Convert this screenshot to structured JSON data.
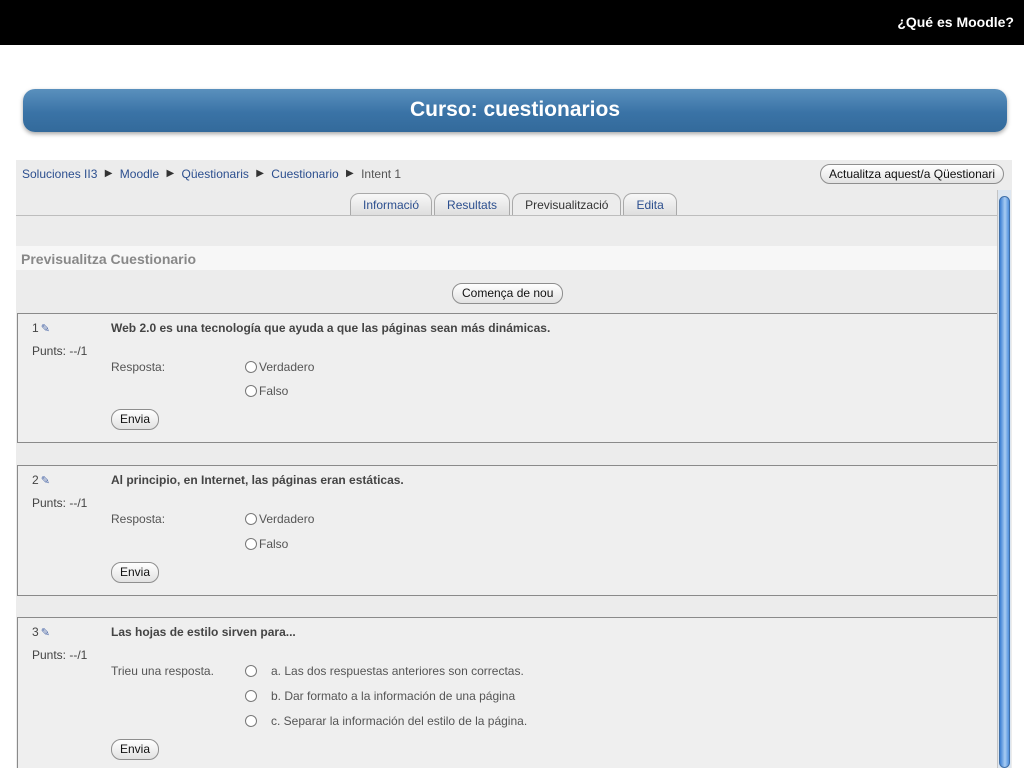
{
  "slide": {
    "header_title": "¿Qué es Moodle?",
    "banner_title": "Curso: cuestionarios"
  },
  "moodle": {
    "breadcrumb": [
      {
        "label": "Soluciones II3",
        "link": true
      },
      {
        "label": "Moodle",
        "link": true
      },
      {
        "label": "Qüestionaris",
        "link": true
      },
      {
        "label": "Cuestionario",
        "link": true
      },
      {
        "label": "Intent 1",
        "link": false
      }
    ],
    "breadcrumb_separator": "▶",
    "update_button": "Actualitza aquest/a Qüestionari",
    "tabs": [
      {
        "label": "Informació",
        "active": false
      },
      {
        "label": "Resultats",
        "active": false
      },
      {
        "label": "Previsualització",
        "active": true
      },
      {
        "label": "Edita",
        "active": false
      }
    ],
    "section_title": "Previsualitza Cuestionario",
    "start_again_button": "Comença de nou",
    "questions": [
      {
        "number": "1",
        "points": "Punts: --/1",
        "text": "Web 2.0 es una tecnología que ayuda a que las páginas sean más dinámicas.",
        "prompt": "Resposta:",
        "options": [
          "Verdadero",
          "Falso"
        ],
        "submit": "Envia"
      },
      {
        "number": "2",
        "points": "Punts: --/1",
        "text": "Al principio, en Internet, las páginas eran estáticas.",
        "prompt": "Resposta:",
        "options": [
          "Verdadero",
          "Falso"
        ],
        "submit": "Envia"
      },
      {
        "number": "3",
        "points": "Punts: --/1",
        "text": "Las hojas de estilo sirven para...",
        "prompt": "Trieu una resposta.",
        "options": [
          "a. Las dos respuestas anteriores son correctas.",
          "b. Dar formato a la información de una página",
          "c. Separar la información del estilo de la página."
        ],
        "submit": "Envia"
      }
    ]
  },
  "icons": {
    "pencil": "pencil-icon",
    "radio": "radio-button-icon"
  },
  "colors": {
    "banner": "#3a73a6",
    "header_bar": "#000000",
    "link": "#2c4f8f"
  }
}
